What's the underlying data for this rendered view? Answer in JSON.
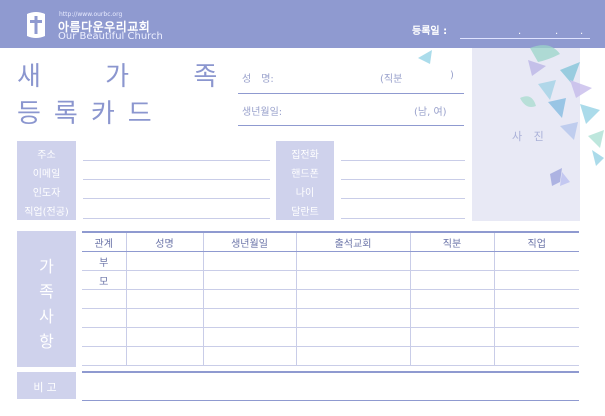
{
  "header": {
    "url": "http://www.ourbc.org",
    "church_kr": "아름다운우리교회",
    "church_en": "Our Beautiful Church",
    "registration_label": "등록일 :",
    "date_dots": [
      ".",
      ".",
      "."
    ]
  },
  "title": {
    "line1": "새 가 족",
    "line2": "등록카드"
  },
  "personal": {
    "name_label": "성　명:",
    "position_label": "(직분",
    "position_close": ")",
    "birth_label": "생년월일:",
    "gender_label": "(남, 여)",
    "photo_label": "사 진"
  },
  "contact_labels_left": [
    "주소",
    "이메일",
    "인도자",
    "직업(전공)"
  ],
  "contact_labels_right": [
    "집전화",
    "핸드폰",
    "나이",
    "달란트"
  ],
  "family": {
    "side_label_chars": [
      "가",
      "족",
      "사",
      "항"
    ],
    "columns": [
      "관계",
      "성명",
      "생년월일",
      "출석교회",
      "직분",
      "직업"
    ],
    "rows": [
      [
        "부",
        "",
        "",
        "",
        "",
        ""
      ],
      [
        "모",
        "",
        "",
        "",
        "",
        ""
      ],
      [
        "",
        "",
        "",
        "",
        "",
        ""
      ],
      [
        "",
        "",
        "",
        "",
        "",
        ""
      ],
      [
        "",
        "",
        "",
        "",
        "",
        ""
      ],
      [
        "",
        "",
        "",
        "",
        "",
        ""
      ]
    ]
  },
  "remarks_label": "비고",
  "colors": {
    "accent": "#8f9ad0",
    "label_box": "#cfd2ec",
    "butterfly": "#7fc3d8"
  }
}
